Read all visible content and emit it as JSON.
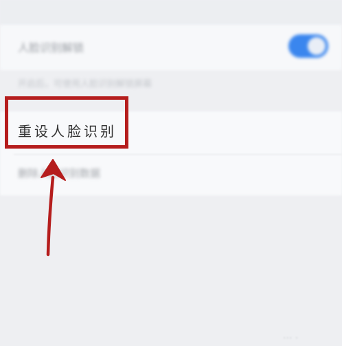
{
  "settings": {
    "toggle_row_label": "人脸识别解锁",
    "toggle_on": true,
    "hint_text": "开启后，可使用人脸识别解锁屏幕",
    "reset_row_label": "重设人脸识别",
    "second_row_label": "删除人脸识别数据"
  },
  "watermark_text": "··· ·",
  "colors": {
    "toggle_accent": "#3a86ee",
    "annotation_red": "#b51d1d"
  }
}
